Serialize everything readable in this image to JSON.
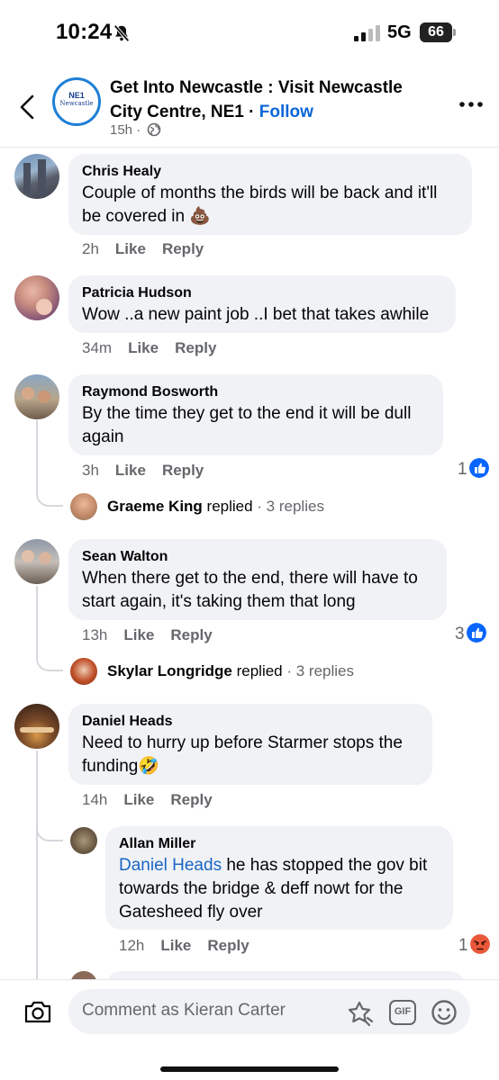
{
  "status_bar": {
    "time": "10:24",
    "network": "5G",
    "battery": "66"
  },
  "header": {
    "page_name": "Get Into Newcastle : Visit Newcastle City Centre, NE1",
    "separator": " · ",
    "follow": "Follow",
    "time": "15h ·",
    "logo_top": "NE1",
    "logo_bottom": "Newcastle"
  },
  "comments": [
    {
      "author": "Chris Healy",
      "text_line1": "Couple of months the birds will be back and it'll",
      "text_line2": "be covered in 💩",
      "time": "2h",
      "like": "Like",
      "reply": "Reply"
    },
    {
      "author": "Patricia Hudson",
      "text": "Wow ..a new paint job ..I bet that takes awhile",
      "time": "34m",
      "like": "Like",
      "reply": "Reply"
    },
    {
      "author": "Raymond Bosworth",
      "text_line1": "By the time they get to the end it will be dull",
      "text_line2": "again",
      "time": "3h",
      "like": "Like",
      "reply": "Reply",
      "reaction_count": "1",
      "replied": {
        "name": "Graeme King",
        "verb": " replied",
        "count": " · 3 replies"
      }
    },
    {
      "author": "Sean Walton",
      "text_line1": "When there get to the end, there will have to",
      "text_line2": "start again, it's taking them that long",
      "time": "13h",
      "like": "Like",
      "reply": "Reply",
      "reaction_count": "3",
      "replied": {
        "name": "Skylar Longridge",
        "verb": " replied",
        "count": " · 3 replies"
      }
    },
    {
      "author": "Daniel Heads",
      "text_line1": "Need to hurry up before Starmer stops the",
      "text_line2": "funding🤣",
      "time": "14h",
      "like": "Like",
      "reply": "Reply"
    }
  ],
  "reply": {
    "author": "Allan Miller",
    "mention": "Daniel Heads",
    "text_line1": " he has stopped the gov bit",
    "text_line2": "towards the bridge & deff nowt for the",
    "text_line3": "Gatesheed fly over",
    "time": "12h",
    "like": "Like",
    "reply": "Reply",
    "reaction_count": "1"
  },
  "composer": {
    "placeholder": "Comment as Kieran Carter",
    "gif": "GIF"
  },
  "colors": {
    "like_blue": "#0866ff",
    "follow_blue": "#0a66d8",
    "angry_red": "#e9583a",
    "bubble_gray": "#f0f2f5"
  },
  "icons": [
    "bell-slash-icon",
    "signal-icon",
    "battery-icon",
    "back-chevron-icon",
    "globe-icon",
    "more-icon",
    "like-reaction-icon",
    "angry-reaction-icon",
    "camera-icon",
    "sticker-icon",
    "gif-icon",
    "emoji-icon"
  ]
}
